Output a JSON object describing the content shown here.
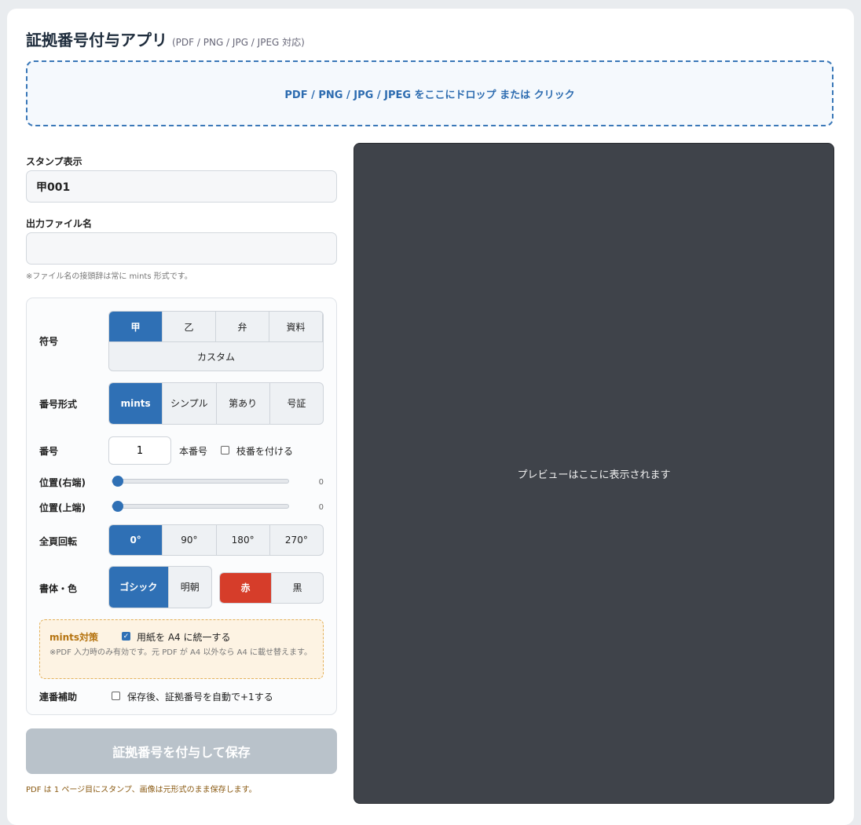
{
  "header": {
    "title": "証拠番号付与アプリ",
    "subtitle": "(PDF / PNG / JPG / JPEG 対応)"
  },
  "dropzone": {
    "text": "PDF / PNG / JPG / JPEG をここにドロップ または クリック"
  },
  "stamp": {
    "label": "スタンプ表示",
    "value": "甲001"
  },
  "output": {
    "label": "出力ファイル名",
    "value": "",
    "hint": "※ファイル名の接頭辞は常に mints 形式です。"
  },
  "panel": {
    "symbol": {
      "label": "符号",
      "options": [
        "甲",
        "乙",
        "弁",
        "資料"
      ],
      "custom": "カスタム",
      "selected": "甲"
    },
    "format": {
      "label": "番号形式",
      "options": [
        "mints",
        "シンプル",
        "第あり",
        "号証"
      ],
      "selected": "mints"
    },
    "number": {
      "label": "番号",
      "value": "1",
      "main_label": "本番号",
      "branch_label": "枝番を付ける",
      "branch_checked": false
    },
    "pos_right": {
      "label": "位置(右端)",
      "value": "0"
    },
    "pos_top": {
      "label": "位置(上端)",
      "value": "0"
    },
    "rotation": {
      "label": "全頁回転",
      "options": [
        "0°",
        "90°",
        "180°",
        "270°"
      ],
      "selected": "0°"
    },
    "font_color": {
      "label": "書体・色",
      "fonts": [
        "ゴシック",
        "明朝"
      ],
      "selected_font": "ゴシック",
      "colors": [
        "赤",
        "黒"
      ],
      "selected_color": "赤",
      "red_color": "#d63d2a"
    },
    "mints": {
      "title": "mints対策",
      "checkbox_label": "用紙を A4 に統一する",
      "checked": true,
      "note": "※PDF 入力時のみ有効です。元 PDF が A4 以外なら A4 に載せ替えます。"
    },
    "serial": {
      "label": "連番補助",
      "checkbox_label": "保存後、証拠番号を自動で+1する",
      "checked": false
    }
  },
  "save_button": "証拠番号を付与して保存",
  "footer_note": "PDF は 1 ページ目にスタンプ、画像は元形式のまま保存します。",
  "preview": {
    "placeholder": "プレビューはここに表示されます"
  },
  "colors": {
    "accent": "#2f70b5",
    "disabled": "#b9c2ca",
    "preview_bg": "#3f434a"
  }
}
